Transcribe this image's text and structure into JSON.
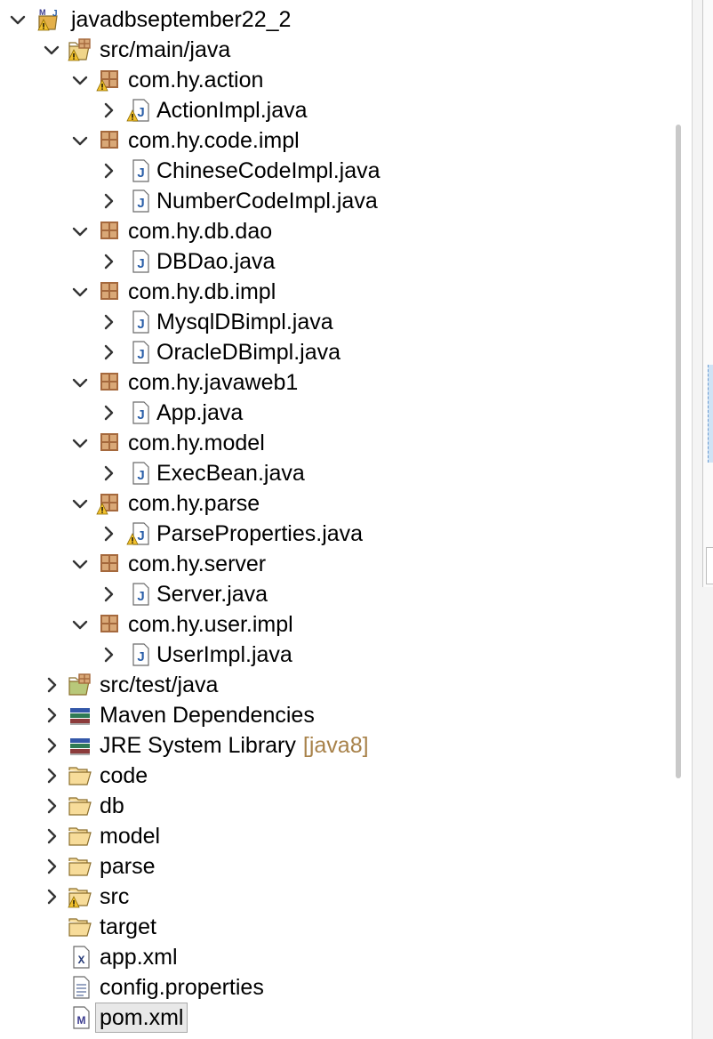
{
  "project_explorer": {
    "rows": [
      {
        "label": "javadbseptember22_2",
        "icon": "maven-java-project-icon",
        "warning": true,
        "expanded": true
      },
      {
        "label": "src/main/java",
        "icon": "source-folder-icon",
        "warning": true,
        "expanded": true
      },
      {
        "label": "com.hy.action",
        "icon": "package-icon",
        "warning": true,
        "expanded": true
      },
      {
        "label": "ActionImpl.java",
        "icon": "java-file-icon",
        "warning": true,
        "expanded": false
      },
      {
        "label": "com.hy.code.impl",
        "icon": "package-icon",
        "warning": false,
        "expanded": true
      },
      {
        "label": "ChineseCodeImpl.java",
        "icon": "java-file-icon",
        "warning": false,
        "expanded": false
      },
      {
        "label": "NumberCodeImpl.java",
        "icon": "java-file-icon",
        "warning": false,
        "expanded": false
      },
      {
        "label": "com.hy.db.dao",
        "icon": "package-icon",
        "warning": false,
        "expanded": true
      },
      {
        "label": "DBDao.java",
        "icon": "java-file-icon",
        "warning": false,
        "expanded": false
      },
      {
        "label": "com.hy.db.impl",
        "icon": "package-icon",
        "warning": false,
        "expanded": true
      },
      {
        "label": "MysqlDBimpl.java",
        "icon": "java-file-icon",
        "warning": false,
        "expanded": false
      },
      {
        "label": "OracleDBimpl.java",
        "icon": "java-file-icon",
        "warning": false,
        "expanded": false
      },
      {
        "label": "com.hy.javaweb1",
        "icon": "package-icon",
        "warning": false,
        "expanded": true
      },
      {
        "label": "App.java",
        "icon": "java-file-icon",
        "warning": false,
        "expanded": false
      },
      {
        "label": "com.hy.model",
        "icon": "package-icon",
        "warning": false,
        "expanded": true
      },
      {
        "label": "ExecBean.java",
        "icon": "java-file-icon",
        "warning": false,
        "expanded": false
      },
      {
        "label": "com.hy.parse",
        "icon": "package-icon",
        "warning": true,
        "expanded": true
      },
      {
        "label": "ParseProperties.java",
        "icon": "java-file-icon",
        "warning": true,
        "expanded": false
      },
      {
        "label": "com.hy.server",
        "icon": "package-icon",
        "warning": false,
        "expanded": true
      },
      {
        "label": "Server.java",
        "icon": "java-file-icon",
        "warning": false,
        "expanded": false
      },
      {
        "label": "com.hy.user.impl",
        "icon": "package-icon",
        "warning": false,
        "expanded": true
      },
      {
        "label": "UserImpl.java",
        "icon": "java-file-icon",
        "warning": false,
        "expanded": false
      },
      {
        "label": "src/test/java",
        "icon": "test-source-folder-icon",
        "warning": false,
        "expanded": false
      },
      {
        "label": "Maven Dependencies",
        "icon": "library-icon",
        "warning": false,
        "expanded": false
      },
      {
        "label": "JRE System Library",
        "decoration": "[java8]",
        "icon": "library-icon",
        "warning": false,
        "expanded": false
      },
      {
        "label": "code",
        "icon": "folder-icon",
        "warning": false,
        "expanded": false
      },
      {
        "label": "db",
        "icon": "folder-icon",
        "warning": false,
        "expanded": false
      },
      {
        "label": "model",
        "icon": "folder-icon",
        "warning": false,
        "expanded": false
      },
      {
        "label": "parse",
        "icon": "folder-icon",
        "warning": false,
        "expanded": false
      },
      {
        "label": "src",
        "icon": "folder-icon",
        "warning": true,
        "expanded": false
      },
      {
        "label": "target",
        "icon": "folder-icon",
        "warning": false,
        "expanded": null
      },
      {
        "label": "app.xml",
        "icon": "xml-file-icon",
        "warning": false,
        "expanded": null
      },
      {
        "label": "config.properties",
        "icon": "properties-file-icon",
        "warning": false,
        "expanded": null
      },
      {
        "label": "pom.xml",
        "icon": "maven-pom-icon",
        "warning": false,
        "expanded": null,
        "selected": true
      }
    ]
  },
  "colors": {
    "package": "#a5693d",
    "java_badge": "#2b5fa8",
    "folder": "#e4b04a",
    "warning": "#f2c12e",
    "decoration": "#a8824a"
  }
}
